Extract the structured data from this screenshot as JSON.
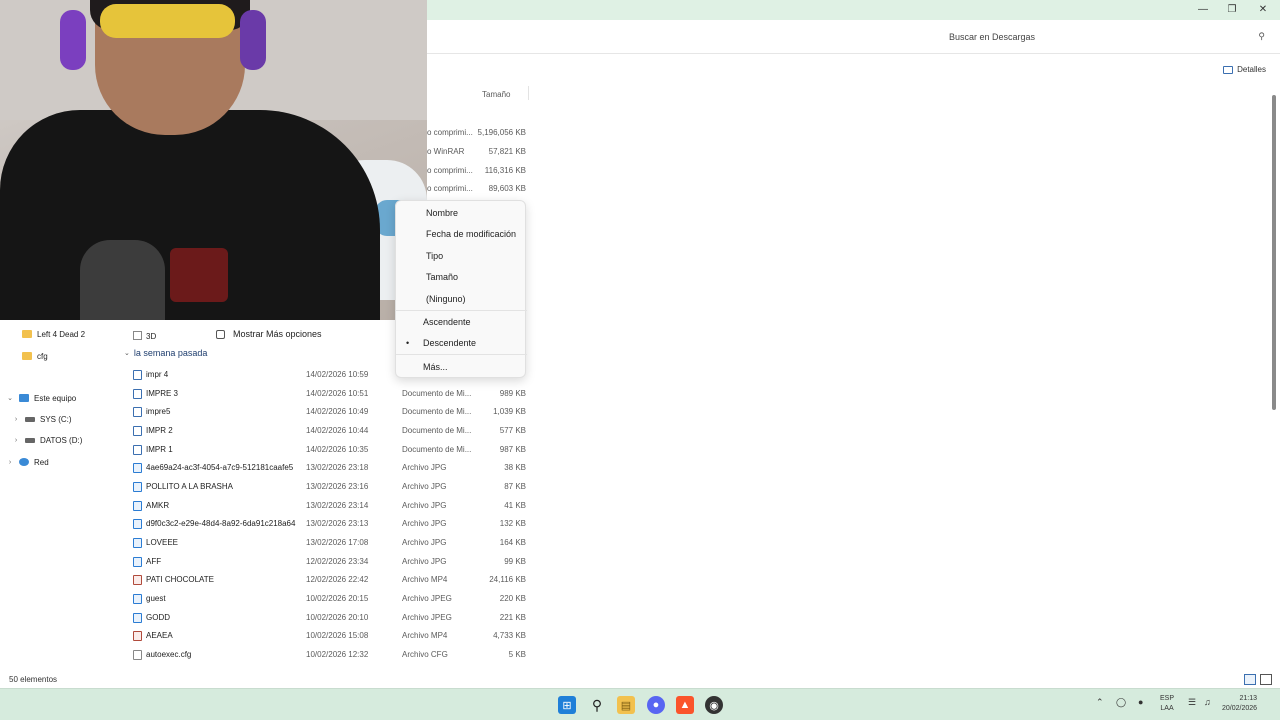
{
  "window": {
    "minimize": "—",
    "maximize": "❐",
    "close": "✕"
  },
  "search": {
    "placeholder": "Buscar en Descargas",
    "icon": "search-icon"
  },
  "toolbar": {
    "details_label": "Detalles"
  },
  "columns": {
    "size": "Tamaño"
  },
  "top_rows": [
    {
      "type": "o comprimi...",
      "size": "5,196,056 KB"
    },
    {
      "type": "o WinRAR",
      "size": "57,821 KB"
    },
    {
      "type": "o comprimi...",
      "size": "116,316 KB"
    },
    {
      "type": "o comprimi...",
      "size": "89,603 KB"
    }
  ],
  "sort_menu": {
    "items": [
      "Nombre",
      "Fecha de modificación",
      "Tipo",
      "Tamaño",
      "(Ninguno)"
    ],
    "ascending": "Ascendente",
    "descending": "Descendente",
    "more": "Más..."
  },
  "context": {
    "more_options": "Mostrar Más opciones"
  },
  "sidebar": {
    "items": [
      {
        "label": "Left 4 Dead 2"
      },
      {
        "label": "cfg"
      },
      {
        "label": "Este equipo"
      },
      {
        "label": "SYS (C:)"
      },
      {
        "label": "DATOS (D:)"
      },
      {
        "label": "Red"
      }
    ]
  },
  "list": {
    "row_3d": "3D",
    "group_label": "la semana pasada",
    "files": [
      {
        "name": "impr 4",
        "date": "14/02/2026 10:59",
        "type": "Documento de Mi...",
        "size": "",
        "kind": "doc"
      },
      {
        "name": "IMPRE 3",
        "date": "14/02/2026 10:51",
        "type": "Documento de Mi...",
        "size": "989 KB",
        "kind": "doc"
      },
      {
        "name": "impre5",
        "date": "14/02/2026 10:49",
        "type": "Documento de Mi...",
        "size": "1,039 KB",
        "kind": "doc"
      },
      {
        "name": "IMPR 2",
        "date": "14/02/2026 10:44",
        "type": "Documento de Mi...",
        "size": "577 KB",
        "kind": "doc"
      },
      {
        "name": "IMPR 1",
        "date": "14/02/2026 10:35",
        "type": "Documento de Mi...",
        "size": "987 KB",
        "kind": "doc"
      },
      {
        "name": "4ae69a24-ac3f-4054-a7c9-512181caafe5",
        "date": "13/02/2026 23:18",
        "type": "Archivo JPG",
        "size": "38 KB",
        "kind": "jpg"
      },
      {
        "name": "POLLITO A LA BRASHA",
        "date": "13/02/2026 23:16",
        "type": "Archivo JPG",
        "size": "87 KB",
        "kind": "jpg"
      },
      {
        "name": "AMKR",
        "date": "13/02/2026 23:14",
        "type": "Archivo JPG",
        "size": "41 KB",
        "kind": "jpg"
      },
      {
        "name": "d9f0c3c2-e29e-48d4-8a92-6da91c218a64",
        "date": "13/02/2026 23:13",
        "type": "Archivo JPG",
        "size": "132 KB",
        "kind": "jpg"
      },
      {
        "name": "LOVEEE",
        "date": "13/02/2026 17:08",
        "type": "Archivo JPG",
        "size": "164 KB",
        "kind": "jpg"
      },
      {
        "name": "AFF",
        "date": "12/02/2026 23:34",
        "type": "Archivo JPG",
        "size": "99 KB",
        "kind": "jpg"
      },
      {
        "name": "PATI CHOCOLATE",
        "date": "12/02/2026 22:42",
        "type": "Archivo MP4",
        "size": "24,116 KB",
        "kind": "mp4"
      },
      {
        "name": "guest",
        "date": "10/02/2026 20:15",
        "type": "Archivo JPEG",
        "size": "220 KB",
        "kind": "jpg"
      },
      {
        "name": "GODD",
        "date": "10/02/2026 20:10",
        "type": "Archivo JPEG",
        "size": "221 KB",
        "kind": "jpg"
      },
      {
        "name": "AEAEA",
        "date": "10/02/2026 15:08",
        "type": "Archivo MP4",
        "size": "4,733 KB",
        "kind": "mp4"
      },
      {
        "name": "autoexec.cfg",
        "date": "10/02/2026 12:32",
        "type": "Archivo CFG",
        "size": "5 KB",
        "kind": "cfg"
      }
    ]
  },
  "status": {
    "count": "50 elementos"
  },
  "taskbar": {
    "lang_top": "ESP",
    "lang_bottom": "LAA",
    "time": "21:13",
    "date": "20/02/2026"
  }
}
